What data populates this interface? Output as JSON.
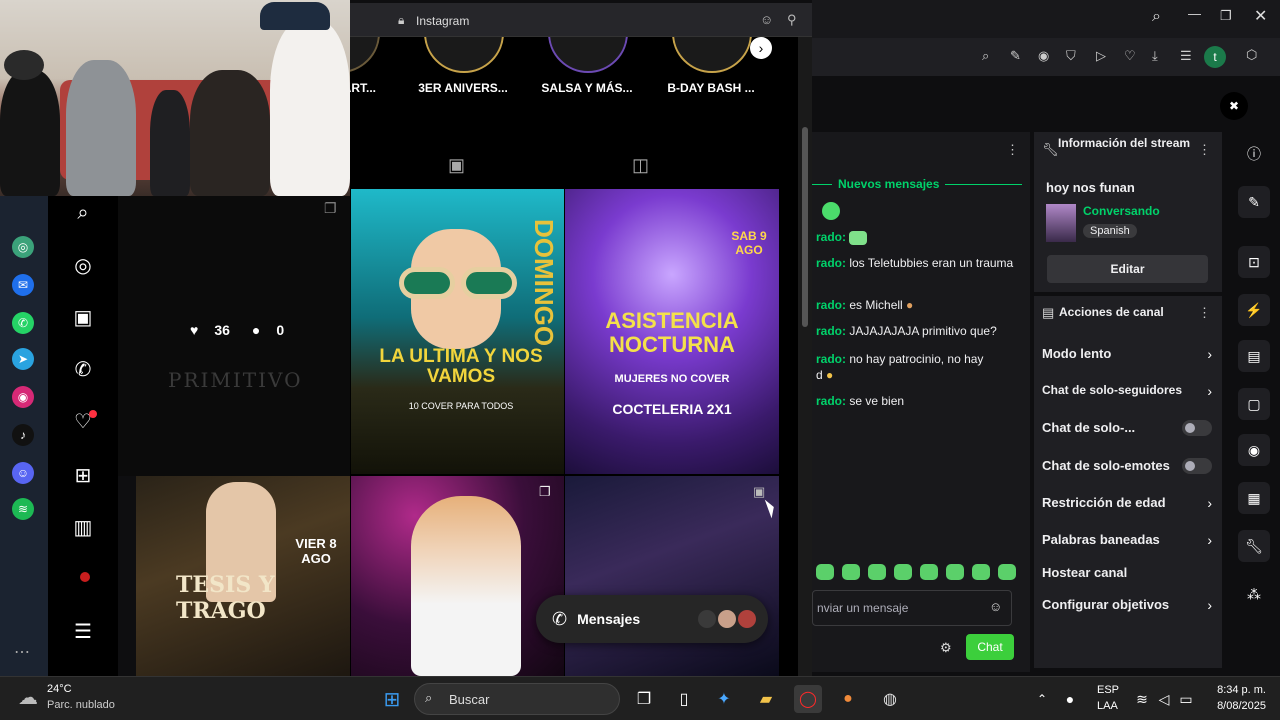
{
  "browser": {
    "title": "Instagram"
  },
  "stories": [
    {
      "label": "ART..."
    },
    {
      "label": "3ER ANIVERS..."
    },
    {
      "label": "SALSA Y MÁS..."
    },
    {
      "label": "B-DAY BASH ..."
    }
  ],
  "post_left": {
    "likes": "36",
    "comments": "0",
    "logo": "PRIMITIVO"
  },
  "posters": {
    "p1": {
      "big": "DOMINGO",
      "title": "LA ULTIMA Y NOS VAMOS",
      "sub": "10 COVER PARA TODOS"
    },
    "p2": {
      "title": "ASISTENCIA NOCTURNA",
      "sub": "MUJERES NO COVER",
      "sub2": "COCTELERIA 2X1",
      "date": "SAB 9 AGO"
    },
    "p3": {
      "title": "TESIS Y TRAGO",
      "date": "VIER 8 AGO"
    }
  },
  "messages_pill": {
    "label": "Mensajes"
  },
  "chat": {
    "new_messages": "Nuevos mensajes",
    "lines": [
      {
        "user": "rado:",
        "text": ""
      },
      {
        "user": "rado:",
        "text": "los Teletubbies eran un trauma"
      },
      {
        "user": "rado:",
        "text": "es Michell"
      },
      {
        "user": "rado:",
        "text": "JAJAJAJAJA primitivo que?"
      },
      {
        "user": "rado:",
        "text": "no hay patrocinio, no hay"
      },
      {
        "user": "d",
        "text": ""
      },
      {
        "user": "rado:",
        "text": "se ve bien"
      }
    ],
    "input_placeholder": "nviar un mensaje",
    "send_label": "Chat"
  },
  "stream_info": {
    "header": "Información del stream",
    "title": "hoy nos funan",
    "category": "Conversando",
    "tag": "Spanish",
    "edit_label": "Editar"
  },
  "channel_actions": {
    "header": "Acciones de canal",
    "items": [
      {
        "label": "Modo lento",
        "control": "chevron"
      },
      {
        "label": "Chat de solo-seguidores",
        "control": "chevron"
      },
      {
        "label": "Chat de solo-...",
        "control": "toggle"
      },
      {
        "label": "Chat de solo-emotes",
        "control": "toggle"
      },
      {
        "label": "Restricción de edad",
        "control": "chevron"
      },
      {
        "label": "Palabras baneadas",
        "control": "chevron"
      },
      {
        "label": "Hostear canal",
        "control": "none"
      },
      {
        "label": "Configurar objetivos",
        "control": "chevron"
      }
    ]
  },
  "taskbar": {
    "weather_temp": "24°C",
    "weather_desc": "Parc. nublado",
    "search_placeholder": "Buscar",
    "lang1": "ESP",
    "lang2": "LAA",
    "time": "8:34 p. m.",
    "date": "8/08/2025"
  },
  "colors": {
    "twitch_green": "#00d26a",
    "chat_button": "#3ccf3c"
  }
}
